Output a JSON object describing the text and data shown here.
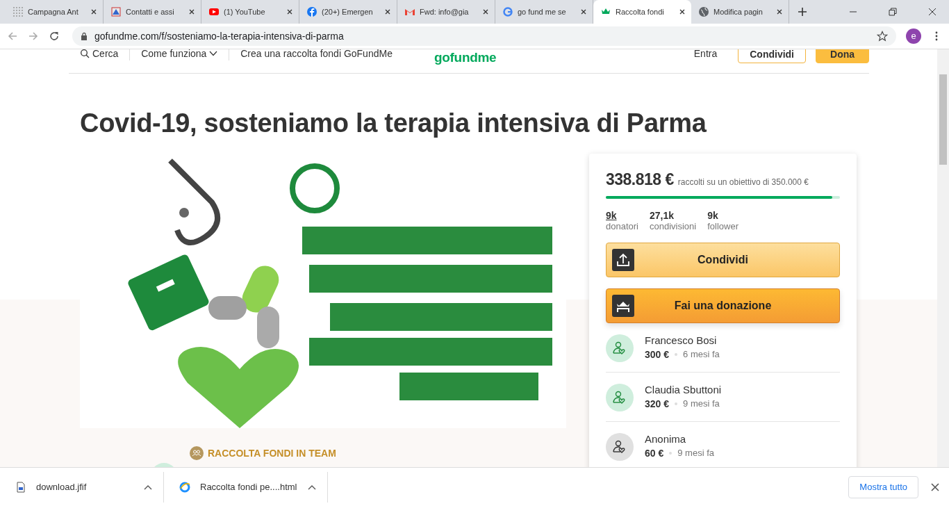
{
  "tabs": [
    {
      "title": "Campagna Ant",
      "kind": "grid",
      "selected": false
    },
    {
      "title": "Contatti e assi",
      "kind": "doc",
      "selected": false
    },
    {
      "title": "(1) YouTube",
      "kind": "youtube",
      "selected": false
    },
    {
      "title": "(20+) Emergen",
      "kind": "facebook",
      "selected": false
    },
    {
      "title": "Fwd: info@gia",
      "kind": "gmail",
      "selected": false
    },
    {
      "title": "go fund me se",
      "kind": "google",
      "selected": false
    },
    {
      "title": "Raccolta fondi",
      "kind": "gofundme",
      "selected": true
    },
    {
      "title": "Modifica pagin",
      "kind": "globe",
      "selected": false
    }
  ],
  "address": "gofundme.com/f/sosteniamo-la-terapia-intensiva-di-parma",
  "profile_initial": "e",
  "nav": {
    "search": "Cerca",
    "how": "Come funziona",
    "create": "Crea una raccolta fondi GoFundMe",
    "logo": "gofundme",
    "login": "Entra",
    "share": "Condividi",
    "donate": "Dona"
  },
  "title": "Covid-19, sosteniamo la terapia intensiva di Parma",
  "team_label": "RACCOLTA FONDI IN TEAM",
  "card": {
    "raised": "338.818 €",
    "goal": "raccolti su un obiettivo di 350.000 €",
    "level": 0.968,
    "stats": [
      {
        "value": "9k",
        "label": "donatori",
        "link": true
      },
      {
        "value": "27,1k",
        "label": "condivisioni",
        "link": false
      },
      {
        "value": "9k",
        "label": "follower",
        "link": false
      }
    ],
    "share_button": "Condividi",
    "donate_button": "Fai una donazione",
    "donations": [
      {
        "name": "Francesco Bosi",
        "amount": "300 €",
        "time": "6 mesi fa",
        "anonymous": false
      },
      {
        "name": "Claudia Sbuttoni",
        "amount": "320 €",
        "time": "9 mesi fa",
        "anonymous": false
      },
      {
        "name": "Anonima",
        "amount": "60 €",
        "time": "9 mesi fa",
        "anonymous": true
      }
    ]
  },
  "downloads": [
    {
      "name": "download.jfif",
      "kind": "file"
    },
    {
      "name": "Raccolta fondi pe....html",
      "kind": "ie"
    }
  ],
  "show_all": "Mostra tutto"
}
